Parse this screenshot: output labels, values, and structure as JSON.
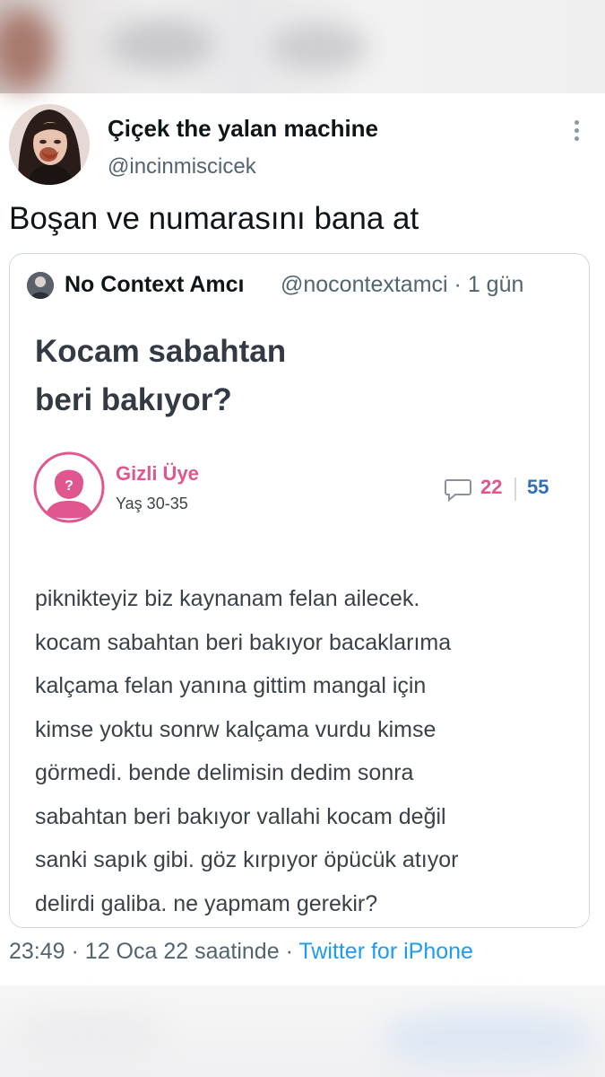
{
  "tweet": {
    "author_name": "Çiçek the yalan machine",
    "author_handle": "@incinmiscicek",
    "text": "Boşan ve numarasını bana at",
    "more_icon": "more-vertical-icon"
  },
  "quoted_tweet": {
    "author_name": "No Context Amcı",
    "author_handle": "@nocontextamci",
    "separator": "·",
    "time_ago": "1 gün",
    "image": {
      "title_line1": "Kocam sabahtan",
      "title_line2": "beri bakıyor?",
      "member_name": "Gizli Üye",
      "member_age": "Yaş 30-35",
      "comment_count": "22",
      "like_count": "55",
      "body_lines": [
        "piknikteyiz biz kaynanam felan ailecek.",
        "kocam sabahtan beri bakıyor bacaklarıma",
        "kalçama felan yanına gittim mangal için",
        "kimse yoktu sonrw kalçama vurdu kimse",
        "görmedi. bende delimisin dedim sonra",
        "sabahtan beri bakıyor vallahi kocam değil",
        "sanki sapık gibi. göz kırpıyor öpücük atıyor",
        "delirdi galiba. ne yapmam gerekir?"
      ]
    }
  },
  "footer": {
    "time": "23:49",
    "sep1": "·",
    "date": "12 Oca 22 saatinde",
    "sep2": "·",
    "source": "Twitter for iPhone"
  },
  "colors": {
    "link": "#1d9bf0",
    "pink_accent": "#e0568f",
    "blue_count": "#2f6fb8",
    "muted": "#536471"
  }
}
